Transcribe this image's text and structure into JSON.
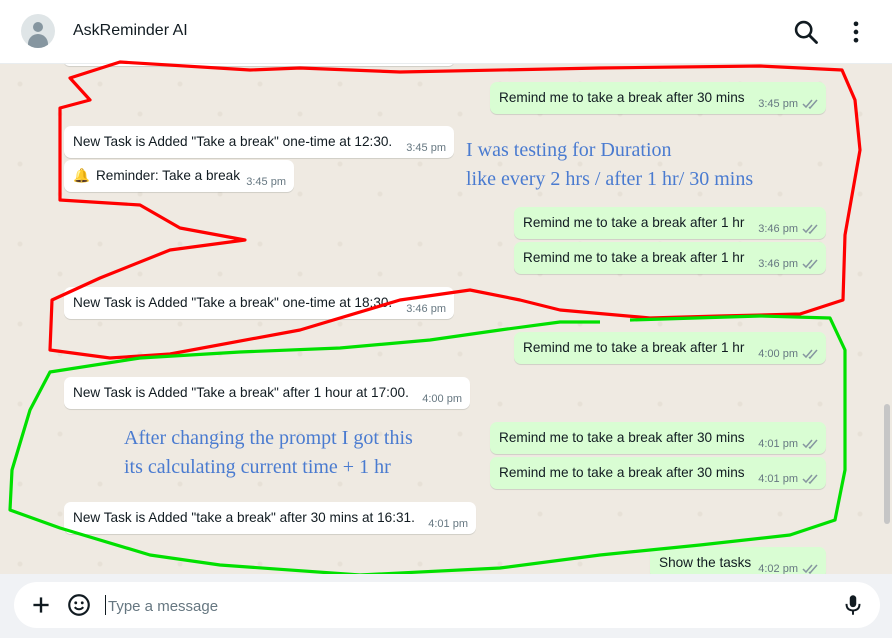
{
  "header": {
    "title": "AskReminder AI",
    "icons": [
      "avatar-icon",
      "search-icon",
      "menu-dots-icon"
    ]
  },
  "messages": [
    {
      "dir": "out",
      "text": "Remind me to take a break after 30 mins",
      "time": "3:45 pm"
    },
    {
      "dir": "in",
      "text": "New Task is Added \"Take a break\" one-time at 12:30.",
      "time": "3:45 pm"
    },
    {
      "dir": "in",
      "text": "Reminder: Take a break",
      "time": "3:45 pm",
      "icon": "bell-icon"
    },
    {
      "dir": "out",
      "text": "Remind me to take a break after 1 hr",
      "time": "3:46 pm"
    },
    {
      "dir": "out",
      "text": "Remind me to take a break after 1 hr",
      "time": "3:46 pm"
    },
    {
      "dir": "in",
      "text": "New Task is Added \"Take a break\" one-time at 18:30.",
      "time": "3:46 pm"
    },
    {
      "dir": "out",
      "text": "Remind me to take a break after 1 hr",
      "time": "4:00 pm"
    },
    {
      "dir": "in",
      "text": "New Task is Added \"Take a break\" after 1 hour at 17:00.",
      "time": "4:00 pm"
    },
    {
      "dir": "out",
      "text": "Remind me to take a break after 30 mins",
      "time": "4:01 pm"
    },
    {
      "dir": "out",
      "text": "Remind me to take a break after 30 mins",
      "time": "4:01 pm"
    },
    {
      "dir": "in",
      "text": "New Task is Added \"take a break\" after 30 mins at 16:31.",
      "time": "4:01 pm"
    },
    {
      "dir": "out",
      "text": "Show the tasks",
      "time": "4:02 pm"
    }
  ],
  "annotations": {
    "red_line1": "I was testing for Duration",
    "red_line2": "like every 2 hrs / after 1 hr/ 30 mins",
    "green_line1": "After changing the prompt I got this",
    "green_line2": "its calculating current time + 1 hr"
  },
  "annotation_colors": {
    "red": "#ff0000",
    "green": "#00e000",
    "text": "#4a7bd0"
  },
  "composer": {
    "placeholder": "Type a message",
    "icons": [
      "plus-icon",
      "sticker-icon",
      "mic-icon"
    ]
  }
}
